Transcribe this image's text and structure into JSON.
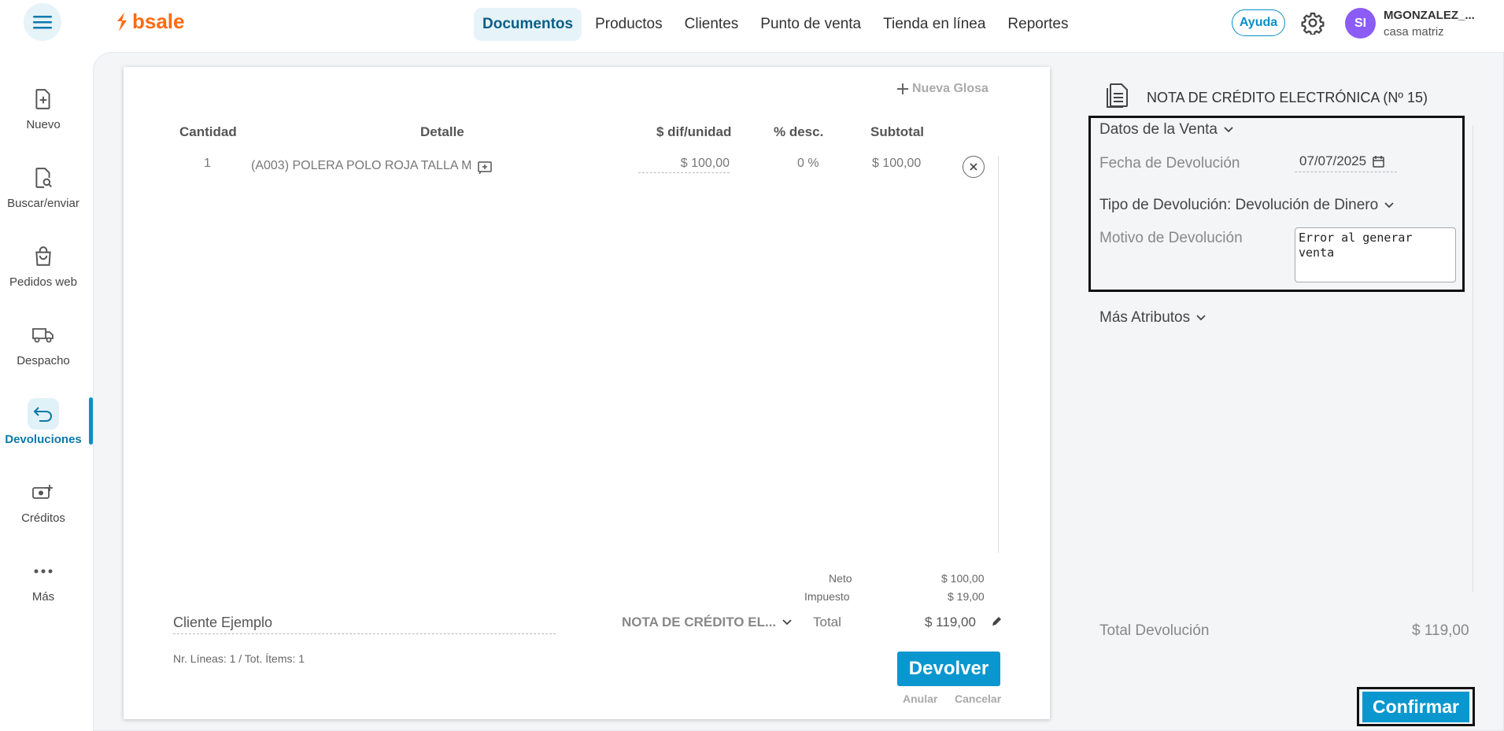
{
  "header": {
    "logo_text": "bsale",
    "nav": [
      {
        "label": "Documentos",
        "active": true
      },
      {
        "label": "Productos"
      },
      {
        "label": "Clientes"
      },
      {
        "label": "Punto de venta"
      },
      {
        "label": "Tienda en línea"
      },
      {
        "label": "Reportes"
      }
    ],
    "help_label": "Ayuda",
    "avatar_initials": "SI",
    "user_name": "MGONZALEZ_...",
    "user_branch": "casa matriz"
  },
  "sidebar": {
    "items": [
      {
        "label": "Nuevo",
        "icon": "file-plus-icon"
      },
      {
        "label": "Buscar/enviar",
        "icon": "file-search-icon"
      },
      {
        "label": "Pedidos web",
        "icon": "shopping-bag-icon"
      },
      {
        "label": "Despacho",
        "icon": "truck-icon"
      },
      {
        "label": "Devoluciones",
        "icon": "return-arrow-icon",
        "active": true
      },
      {
        "label": "Créditos",
        "icon": "money-plus-icon"
      },
      {
        "label": "Más",
        "icon": "more-dots-icon"
      }
    ]
  },
  "document": {
    "new_gloss": "Nueva Glosa",
    "columns": {
      "qty": "Cantidad",
      "detail": "Detalle",
      "unit": "$ dif/unidad",
      "disc": "% desc.",
      "subtotal": "Subtotal"
    },
    "rows": [
      {
        "qty": "1",
        "detail": "(A003) POLERA POLO ROJA TALLA M",
        "unit": "$ 100,00",
        "disc": "0 %",
        "subtotal": "$ 100,00"
      }
    ],
    "totals": {
      "neto_label": "Neto",
      "neto_value": "$ 100,00",
      "tax_label": "Impuesto",
      "tax_value": "$ 19,00",
      "total_label": "Total",
      "total_value": "$ 119,00"
    },
    "client_value": "Cliente Ejemplo",
    "doc_type": "NOTA DE CRÉDITO EL...",
    "lines_info": "Nr. Líneas: 1 / Tot. Ítems: 1",
    "devolver_label": "Devolver",
    "anular_label": "Anular",
    "cancelar_label": "Cancelar"
  },
  "panel": {
    "title": "NOTA DE CRÉDITO ELECTRÓNICA (Nº 15)",
    "sale_data_label": "Datos de la Venta",
    "return_date_label": "Fecha de Devolución",
    "return_date_value": "07/07/2025",
    "return_type_label": "Tipo de Devolución: Devolución de Dinero",
    "reason_label": "Motivo de Devolución",
    "reason_value": "Error al generar venta",
    "more_attrs_label": "Más Atributos",
    "total_return_label": "Total Devolución",
    "total_return_value": "$ 119,00",
    "confirm_label": "Confirmar"
  },
  "colors": {
    "brand": "#ff6a13",
    "accent": "#0a97cf",
    "avatar": "#8b5cf6"
  }
}
